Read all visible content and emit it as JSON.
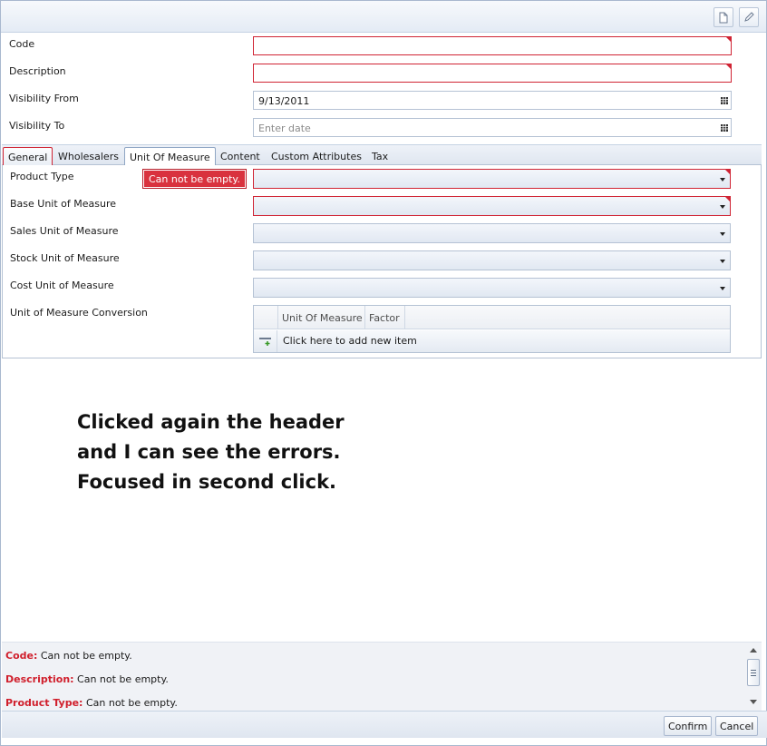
{
  "form": {
    "code_label": "Code",
    "description_label": "Description",
    "visibility_from_label": "Visibility From",
    "visibility_from_value": "9/13/2011",
    "visibility_to_label": "Visibility To",
    "visibility_to_placeholder": "Enter date"
  },
  "tabs": [
    {
      "label": "General",
      "state": "error"
    },
    {
      "label": "Wholesalers",
      "state": "normal"
    },
    {
      "label": "Unit Of Measure",
      "state": "active"
    },
    {
      "label": "Content",
      "state": "normal"
    },
    {
      "label": "Custom Attributes",
      "state": "normal"
    },
    {
      "label": "Tax",
      "state": "normal"
    }
  ],
  "uom": {
    "product_type_label": "Product Type",
    "base_uom_label": "Base Unit of Measure",
    "sales_uom_label": "Sales Unit of Measure",
    "stock_uom_label": "Stock Unit of Measure",
    "cost_uom_label": "Cost Unit of Measure",
    "conversion_label": "Unit of Measure Conversion",
    "tooltip": "Can not be empty.",
    "grid": {
      "columns": [
        "Unit Of Measure",
        "Factor"
      ],
      "add_text": "Click here to add new item"
    }
  },
  "annotation": {
    "lines": [
      "Clicked again the header",
      "and I can see the errors.",
      "Focused in second click."
    ]
  },
  "errors": [
    {
      "field": "Code:",
      "message": "Can not be empty."
    },
    {
      "field": "Description:",
      "message": "Can not be empty."
    },
    {
      "field": "Product Type:",
      "message": "Can not be empty."
    }
  ],
  "footer": {
    "confirm_label": "Confirm",
    "cancel_label": "Cancel"
  },
  "colors": {
    "error": "#d02434",
    "accent": "#c5d2e3"
  },
  "icons": [
    "new-document-icon",
    "edit-pencil-icon",
    "calendar-icon",
    "add-row-icon"
  ]
}
